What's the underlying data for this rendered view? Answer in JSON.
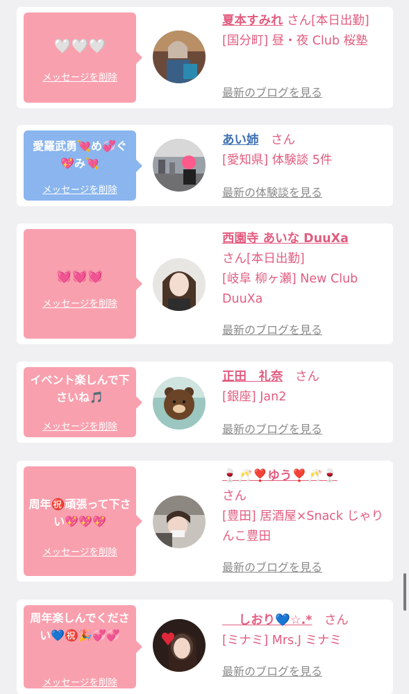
{
  "common": {
    "delete_label": "メッセージを削除"
  },
  "cards": [
    {
      "message": "🤍🤍🤍",
      "name": "夏本すみれ",
      "san": "さん[本日出勤]",
      "location": "[国分町] 昼・夜 Club 桜塾",
      "link": "最新のブログを見る"
    },
    {
      "message": "愛羅武勇💘め💞ぐ💖み💘",
      "name": "あい姉",
      "san": "さん",
      "location": "[愛知県] 体験談 5件",
      "link": "最新の体験談を見る"
    },
    {
      "message": "💓💓💓",
      "name": "西園寺 あいな DuuXa",
      "san": "さん[本日出勤]",
      "location": "[岐阜 柳ヶ瀬] New Club DuuXa",
      "link": "最新のブログを見る"
    },
    {
      "message": "イベント楽しんで下さいね🎵",
      "name": "正田　礼奈",
      "san": "さん",
      "location": "[銀座] Jan2",
      "link": "最新のブログを見る"
    },
    {
      "message": "周年㊗️頑張って下さい💖💖💖",
      "name": "🍷🥂❣️ゆう❣️🥂🍷",
      "san": "さん",
      "location": "[豊田] 居酒屋×Snack じゃりんこ豊田",
      "link": "最新のブログを見る"
    },
    {
      "message": "周年楽しんでください💙㊗️🎉💞💞",
      "name": "　 しおり💙☆.*",
      "san": "さん",
      "location": "[ミナミ] Mrs.J ミナミ",
      "link": "最新のブログを見る"
    }
  ],
  "colors": {
    "page_bg": "#f0f0f2",
    "bubble_pink": "#f9a0ae",
    "bubble_blue": "#8ab5ee",
    "name_pink": "#e25c7f",
    "name_blue": "#3c6fb2",
    "link_gray": "#8a8a8a"
  }
}
